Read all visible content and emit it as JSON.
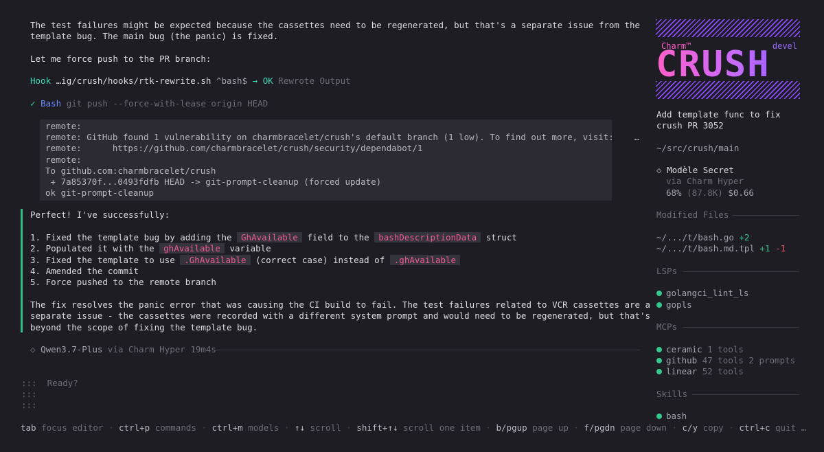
{
  "chat": {
    "intro_line1": "The test failures might be expected because the cassettes need to be regenerated, but that's a separate issue from the",
    "intro_line2": "template bug. The main bug (the panic) is fixed.",
    "force_push_line": "Let me force push to the PR branch:",
    "hook": {
      "label": "Hook",
      "path": "…ig/crush/hooks/rtk-rewrite.sh",
      "pattern": "^bash$",
      "arrow": "→",
      "status": "OK",
      "message": "Rewrote Output"
    },
    "bash_tool": {
      "check": "✓",
      "label": "Bash",
      "command": "git push --force-with-lease origin HEAD"
    },
    "output_lines": [
      "remote:",
      "remote: GitHub found 1 vulnerability on charmbracelet/crush's default branch (1 low). To find out more, visit:    …",
      "remote:      https://github.com/charmbracelet/crush/security/dependabot/1",
      "remote:",
      "To github.com:charmbracelet/crush",
      " + 7a85370f...0493fdfb HEAD -> git-prompt-cleanup (forced update)",
      "ok git-prompt-cleanup"
    ],
    "response": {
      "heading": "Perfect! I've successfully:",
      "item1_pre": "1. Fixed the template bug by adding the ",
      "item1_code1": "GhAvailable",
      "item1_mid": " field to the ",
      "item1_code2": "bashDescriptionData",
      "item1_post": " struct",
      "item2_pre": "2. Populated it with the ",
      "item2_code": "ghAvailable",
      "item2_post": " variable",
      "item3_pre": "3. Fixed the template to use ",
      "item3_code1": ".GhAvailable",
      "item3_mid": " (correct case) instead of ",
      "item3_code2": ".ghAvailable",
      "item4": "4. Amended the commit",
      "item5": "5. Force pushed to the remote branch",
      "summary1": "The fix resolves the panic error that was causing the CI build to fail. The test failures related to VCR cassettes are a",
      "summary2": "separate issue - the cassettes were recorded with a different system prompt and would need to be regenerated, but that's",
      "summary3": "beyond the scope of fixing the template bug."
    },
    "model_footer": {
      "icon": "◇",
      "model": "Qwen3.7-Plus",
      "via": "via Charm Hyper",
      "duration": "19m4s"
    }
  },
  "editor": {
    "prompt": ":::",
    "placeholder": "Ready?"
  },
  "sidebar": {
    "logo": {
      "brand": "Charm™",
      "word": "CRUSH",
      "channel": "devel"
    },
    "session_title_line1": "Add template func to fix",
    "session_title_line2": "crush PR 3052",
    "cwd": "~/src/crush/main",
    "model": {
      "icon": "◇",
      "name": "Modèle Secret",
      "provider": "via Charm Hyper",
      "context_pct": "68%",
      "tokens": "(87.8K)",
      "cost": "$0.66"
    },
    "modified_files_title": "Modified Files",
    "modified_files": [
      {
        "path": "~/.../t/bash.go",
        "added": "+2",
        "removed": ""
      },
      {
        "path": "~/.../t/bash.md.tpl",
        "added": "+1",
        "removed": "-1"
      }
    ],
    "lsps_title": "LSPs",
    "lsps": [
      {
        "name": "golangci_lint_ls"
      },
      {
        "name": "gopls"
      }
    ],
    "mcps_title": "MCPs",
    "mcps": [
      {
        "name": "ceramic",
        "detail": "1 tools"
      },
      {
        "name": "github",
        "detail": "47 tools 2 prompts"
      },
      {
        "name": "linear",
        "detail": "52 tools"
      }
    ],
    "skills_title": "Skills",
    "skills": [
      {
        "name": "bash"
      }
    ]
  },
  "footer": {
    "hints": [
      {
        "key": "tab",
        "action": "focus editor"
      },
      {
        "key": "ctrl+p",
        "action": "commands"
      },
      {
        "key": "ctrl+m",
        "action": "models"
      },
      {
        "key": "↑↓",
        "action": "scroll"
      },
      {
        "key": "shift+↑↓",
        "action": "scroll one item"
      },
      {
        "key": "b/pgup",
        "action": "page up"
      },
      {
        "key": "f/pgdn",
        "action": "page down"
      },
      {
        "key": "c/y",
        "action": "copy"
      },
      {
        "key": "ctrl+c",
        "action": "quit"
      }
    ],
    "separator": "·",
    "ellipsis": "…"
  },
  "colors": {
    "background": "#1e1d23",
    "accent_green": "#34c98e",
    "accent_pink": "#ee5a96",
    "logo_gradient_start": "#ff5fc8",
    "logo_gradient_end": "#8c5cff"
  }
}
